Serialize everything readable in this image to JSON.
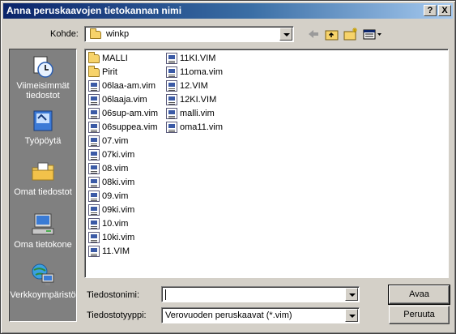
{
  "window": {
    "title": "Anna peruskaavojen tietokannan nimi",
    "help_label": "?",
    "close_label": "X"
  },
  "lookin": {
    "label": "Kohde:",
    "value": "winkp"
  },
  "places": [
    {
      "label": "Viimeisimmät tiedostot",
      "icon": "recent-documents-icon"
    },
    {
      "label": "Työpöytä",
      "icon": "desktop-icon"
    },
    {
      "label": "Omat tiedostot",
      "icon": "my-documents-icon"
    },
    {
      "label": "Oma tietokone",
      "icon": "my-computer-icon"
    },
    {
      "label": "Verkkoympäristö",
      "icon": "network-places-icon"
    }
  ],
  "files": {
    "column1": [
      {
        "name": "MALLI",
        "type": "folder"
      },
      {
        "name": "Pirit",
        "type": "folder"
      },
      {
        "name": "06laa-am.vim",
        "type": "file"
      },
      {
        "name": "06laaja.vim",
        "type": "file"
      },
      {
        "name": "06sup-am.vim",
        "type": "file"
      },
      {
        "name": "06suppea.vim",
        "type": "file"
      },
      {
        "name": "07.vim",
        "type": "file"
      },
      {
        "name": "07ki.vim",
        "type": "file"
      },
      {
        "name": "08.vim",
        "type": "file"
      },
      {
        "name": "08ki.vim",
        "type": "file"
      },
      {
        "name": "09.vim",
        "type": "file"
      },
      {
        "name": "09ki.vim",
        "type": "file"
      },
      {
        "name": "10.vim",
        "type": "file"
      },
      {
        "name": "10ki.vim",
        "type": "file"
      },
      {
        "name": "11.VIM",
        "type": "file"
      }
    ],
    "column2": [
      {
        "name": "11KI.VIM",
        "type": "file"
      },
      {
        "name": "11oma.vim",
        "type": "file"
      },
      {
        "name": "12.VIM",
        "type": "file"
      },
      {
        "name": "12KI.VIM",
        "type": "file"
      },
      {
        "name": "malli.vim",
        "type": "file"
      },
      {
        "name": "oma11.vim",
        "type": "file"
      }
    ]
  },
  "filename": {
    "label": "Tiedostonimi:",
    "value": ""
  },
  "filetype": {
    "label": "Tiedostotyyppi:",
    "value": "Verovuoden peruskaavat (*.vim)"
  },
  "buttons": {
    "open": "Avaa",
    "cancel": "Peruuta"
  }
}
